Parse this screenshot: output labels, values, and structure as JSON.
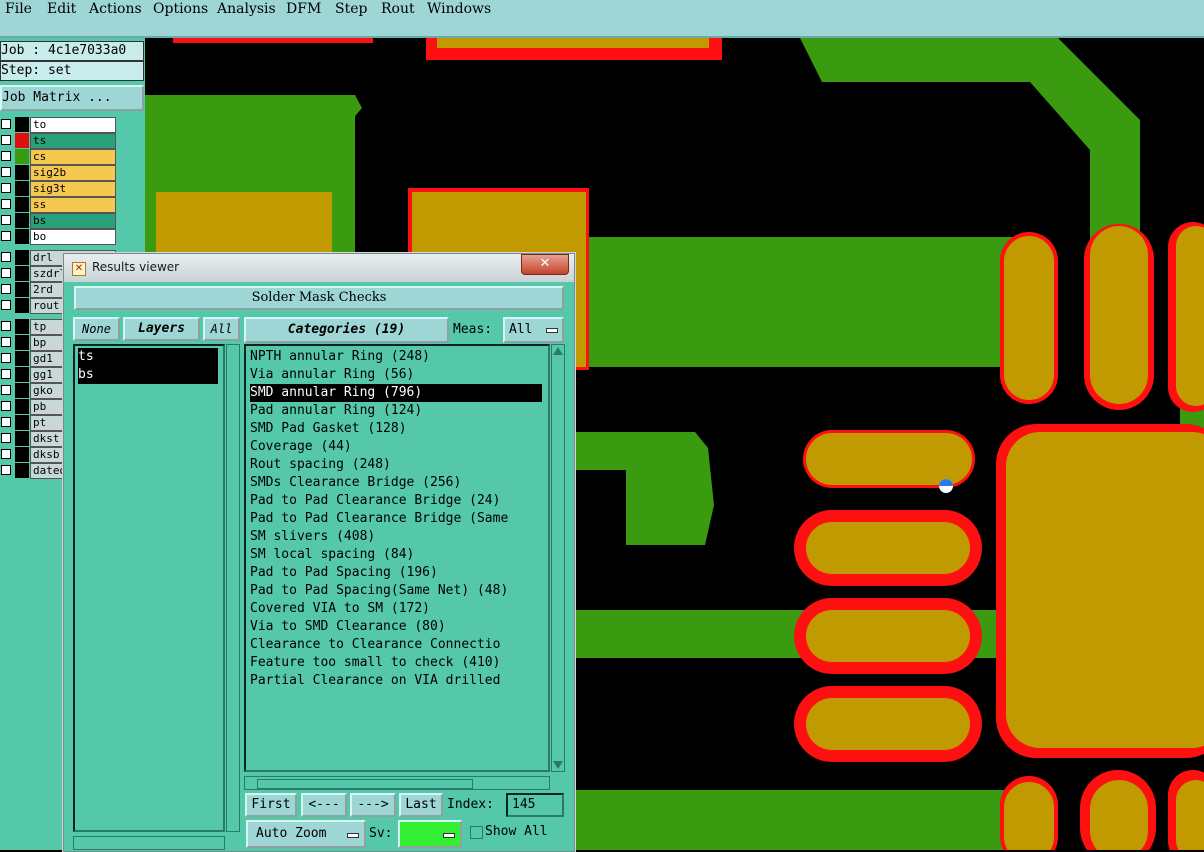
{
  "menu": [
    "File",
    "Edit",
    "Actions",
    "Options",
    "Analysis",
    "DFM",
    "Step",
    "Rout",
    "Windows"
  ],
  "left_panel": {
    "job": "Job : 4c1e7033a0",
    "step": "Step: set",
    "job_matrix_button": "Job Matrix ...",
    "layers_group1": [
      {
        "name": "to",
        "swatch": "#000000",
        "bg": "#ffffff"
      },
      {
        "name": "ts",
        "swatch": "#e01010",
        "bg": "#2aa07a"
      },
      {
        "name": "cs",
        "swatch": "#3a9a10",
        "bg": "#f5c850"
      },
      {
        "name": "sig2b",
        "swatch": "#000000",
        "bg": "#f5c850"
      },
      {
        "name": "sig3t",
        "swatch": "#000000",
        "bg": "#f5c850"
      },
      {
        "name": "ss",
        "swatch": "#000000",
        "bg": "#f5c850"
      },
      {
        "name": "bs",
        "swatch": "#000000",
        "bg": "#2aa07a"
      },
      {
        "name": "bo",
        "swatch": "#000000",
        "bg": "#ffffff"
      }
    ],
    "layers_group2": [
      {
        "name": "drl",
        "swatch": "#000000",
        "bg": "#c8d8d8"
      },
      {
        "name": "szdrl",
        "swatch": "#000000",
        "bg": "#c8d8d8"
      },
      {
        "name": "2rd",
        "swatch": "#000000",
        "bg": "#c8d8d8"
      },
      {
        "name": "rout",
        "swatch": "#000000",
        "bg": "#c8d8d8"
      }
    ],
    "layers_group3": [
      {
        "name": "tp",
        "swatch": "#000000",
        "bg": "#c8d8d8"
      },
      {
        "name": "bp",
        "swatch": "#000000",
        "bg": "#c8d8d8"
      },
      {
        "name": "gd1",
        "swatch": "#000000",
        "bg": "#c8d8d8"
      },
      {
        "name": "gg1",
        "swatch": "#000000",
        "bg": "#c8d8d8"
      },
      {
        "name": "gko",
        "swatch": "#000000",
        "bg": "#c8d8d8"
      },
      {
        "name": "pb",
        "swatch": "#000000",
        "bg": "#c8d8d8"
      },
      {
        "name": "pt",
        "swatch": "#000000",
        "bg": "#c8d8d8"
      },
      {
        "name": "dkst",
        "swatch": "#000000",
        "bg": "#c8d8d8"
      },
      {
        "name": "dksb",
        "swatch": "#000000",
        "bg": "#c8d8d8"
      },
      {
        "name": "dated",
        "swatch": "#000000",
        "bg": "#c8d8d8"
      }
    ]
  },
  "dialog": {
    "title": "Results viewer",
    "close_label": "✕",
    "header": "Solder Mask Checks",
    "none_label": "None",
    "layers_label": "Layers",
    "all_label": "All",
    "layers": [
      "ts",
      "bs"
    ],
    "categories_label": "Categories (19)",
    "meas_label": "Meas:",
    "meas_value": "All",
    "categories": [
      "NPTH annular Ring (248)",
      "Via annular Ring (56)",
      "SMD annular Ring (796)",
      "Pad annular Ring (124)",
      "SMD Pad Gasket (128)",
      "Coverage (44)",
      "Rout spacing (248)",
      "SMDs Clearance Bridge (256)",
      "Pad to Pad Clearance Bridge (24)",
      "Pad to Pad Clearance Bridge (Same",
      "SM slivers (408)",
      "SM local spacing (84)",
      "Pad to Pad Spacing (196)",
      "Pad to Pad Spacing(Same Net) (48)",
      "Covered VIA to SM (172)",
      "Via to SMD Clearance (80)",
      "Clearance to Clearance Connectio",
      "Feature too small to check (410)",
      "Partial Clearance on VIA drilled"
    ],
    "selected_category_index": 2,
    "first_label": "First",
    "prev_label": "<---",
    "next_label": "--->",
    "last_label": "Last",
    "index_label": "Index:",
    "index_value": "145",
    "auto_zoom_label": "Auto Zoom",
    "sv_label": "Sv:",
    "show_all_label": "Show All",
    "sv_color": "#33ee33"
  },
  "colors": {
    "menu_bg": "#9ed6d6",
    "panel_bg": "#55c8aa",
    "copper_green": "#3a9a10",
    "pad_gold": "#c09a00",
    "mask_red": "#ff1010"
  }
}
